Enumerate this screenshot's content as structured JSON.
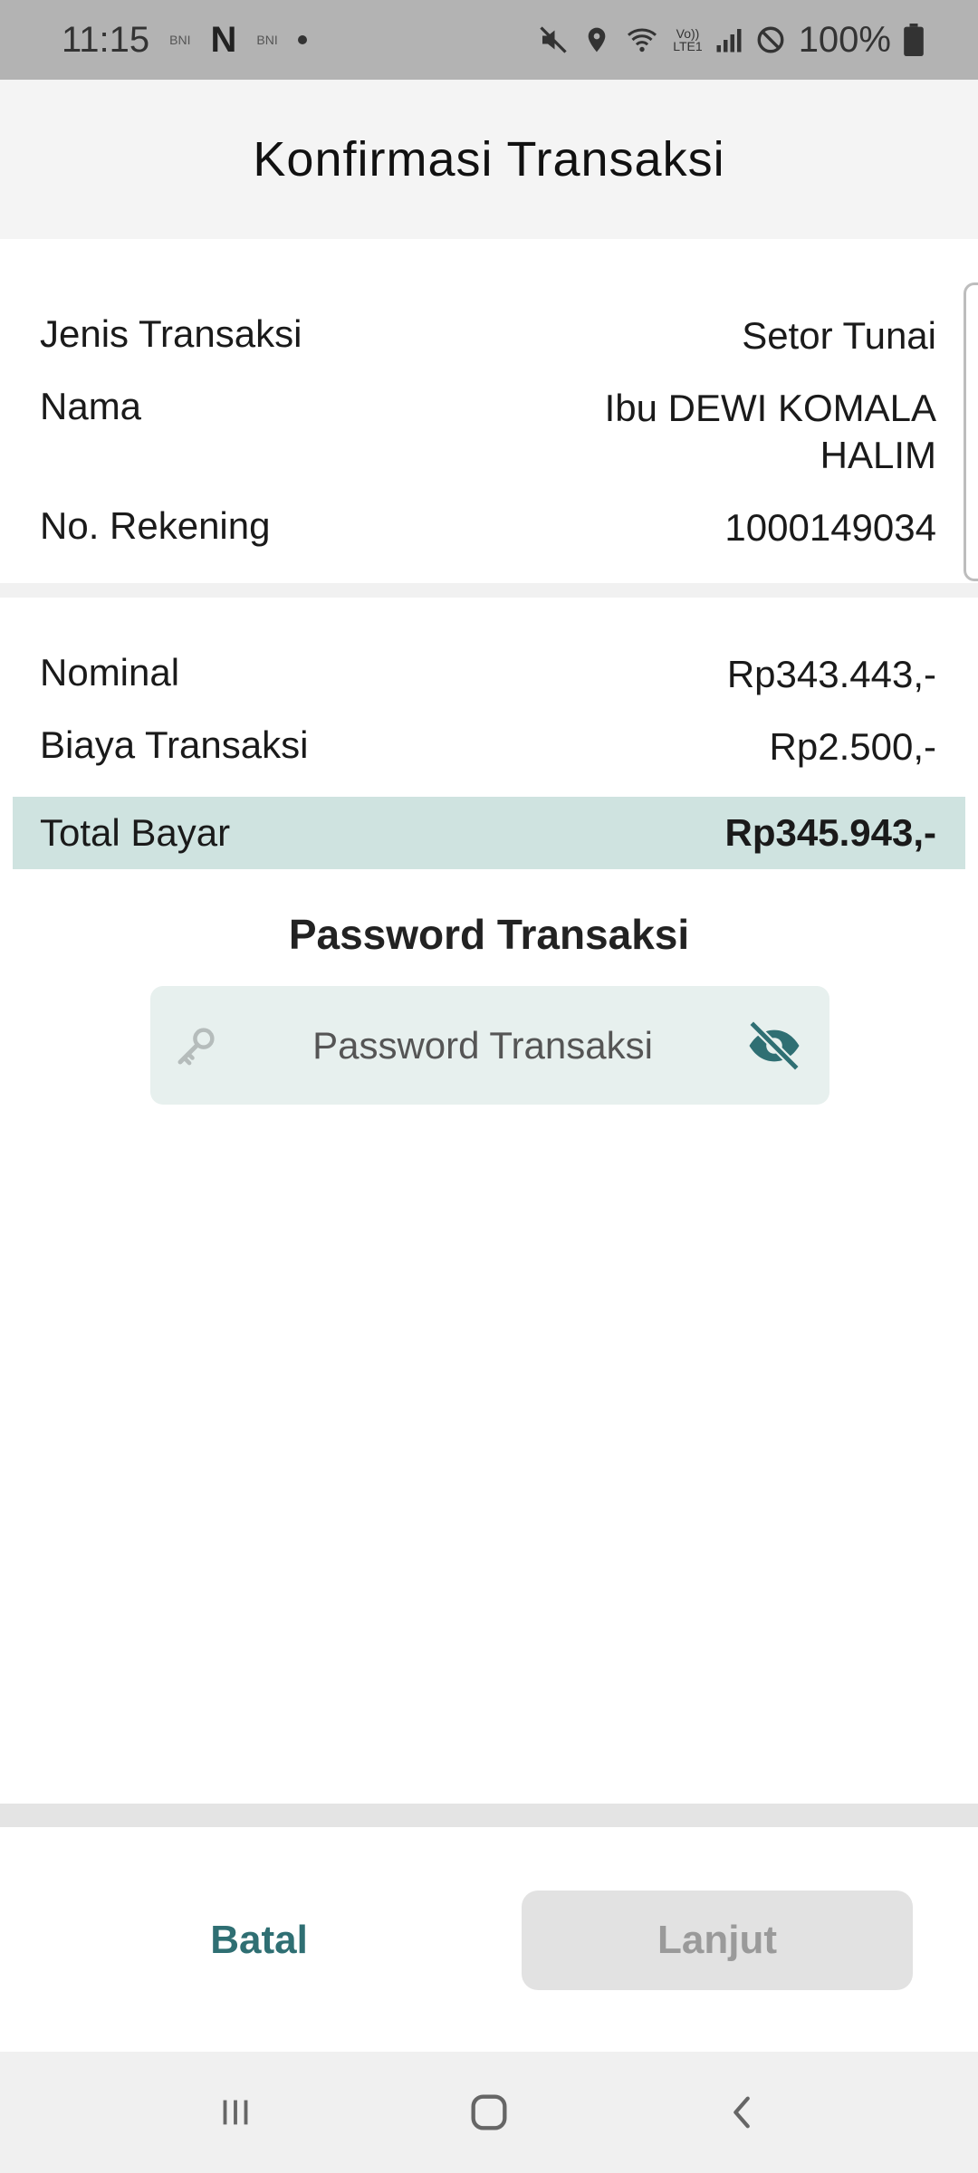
{
  "status_bar": {
    "time": "11:15",
    "notif_1": "BNI",
    "notif_2": "N",
    "notif_3": "BNI",
    "network_label_1": "Vo))",
    "network_label_2": "LTE1",
    "battery": "100%"
  },
  "header": {
    "title": "Konfirmasi Transaksi"
  },
  "details": [
    {
      "label": "Jenis Transaksi",
      "value": "Setor Tunai"
    },
    {
      "label": "Nama",
      "value": "Ibu DEWI KOMALA\nHALIM"
    },
    {
      "label": "No. Rekening",
      "value": "1000149034"
    }
  ],
  "amounts": [
    {
      "label": "Nominal",
      "value": "Rp343.443,-"
    },
    {
      "label": "Biaya Transaksi",
      "value": "Rp2.500,-"
    }
  ],
  "total": {
    "label": "Total Bayar",
    "value": "Rp345.943,-"
  },
  "password": {
    "title": "Password Transaksi",
    "placeholder": "Password Transaksi",
    "value": ""
  },
  "actions": {
    "cancel_label": "Batal",
    "next_label": "Lanjut"
  },
  "icons": {
    "password_prefix": "key-icon",
    "visibility_toggle": "eye-off-icon",
    "nav_recent": "recent-apps-icon",
    "nav_home": "home-icon",
    "nav_back": "back-icon"
  },
  "colors": {
    "accent": "#2f6f73",
    "total_bg": "#cfe3e0",
    "field_bg": "#e7f0ee",
    "disabled_btn": "#e2e2e2"
  }
}
